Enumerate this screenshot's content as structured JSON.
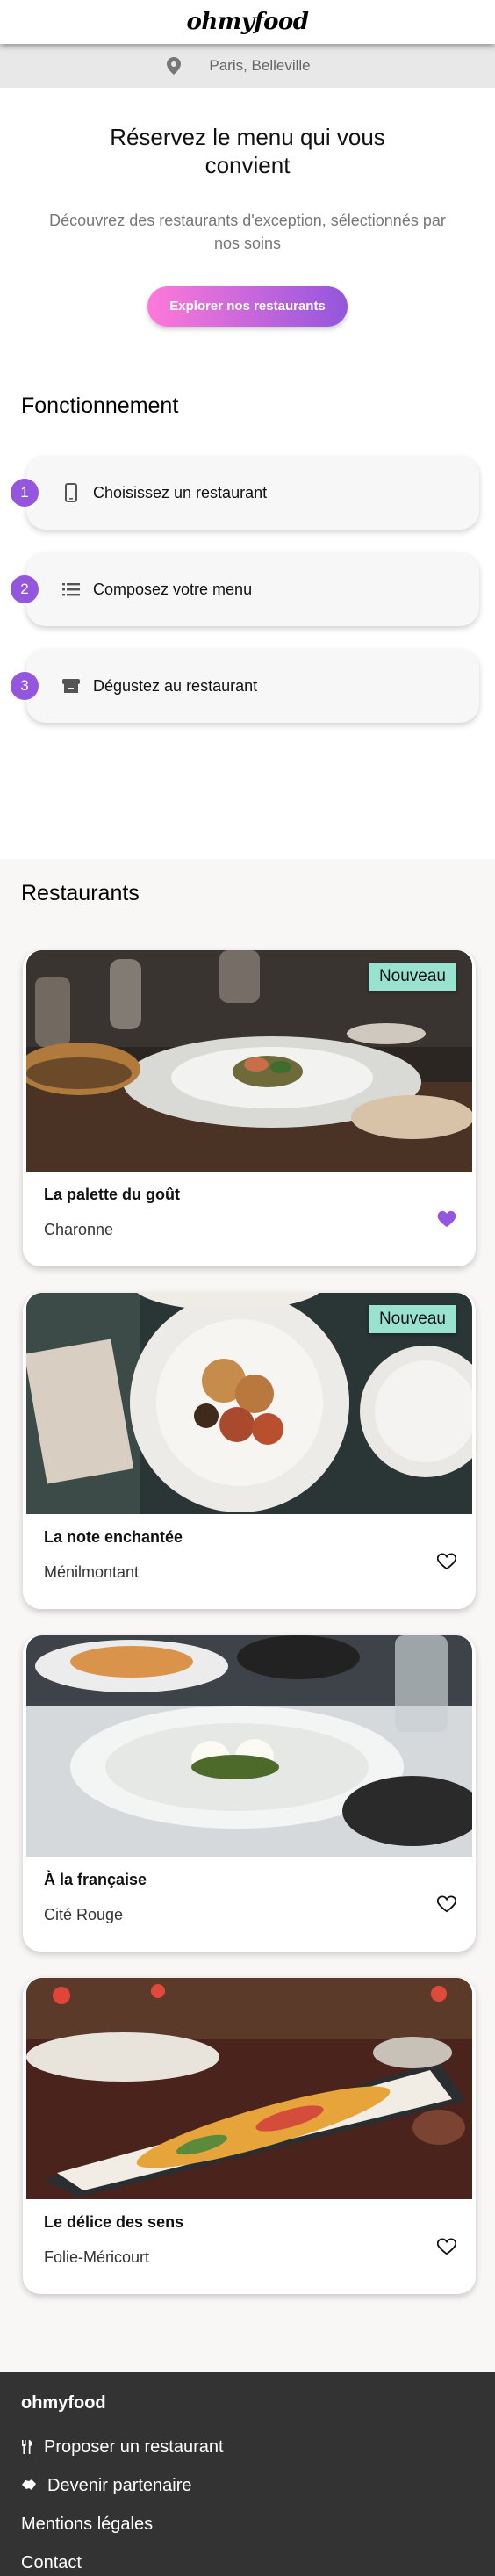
{
  "header": {
    "logo": "ohmyfood"
  },
  "location": {
    "text": "Paris, Belleville",
    "icon": "map-pin-icon"
  },
  "hero": {
    "title": "Réservez le menu qui vous convient",
    "subtitle": "Découvrez des restaurants d'exception, sélectionnés par nos soins",
    "cta_label": "Explorer nos restaurants"
  },
  "how": {
    "title": "Fonctionnement",
    "steps": [
      {
        "num": "1",
        "label": "Choisissez un restaurant",
        "icon": "phone-icon"
      },
      {
        "num": "2",
        "label": "Composez votre menu",
        "icon": "list-icon"
      },
      {
        "num": "3",
        "label": "Dégustez au restaurant",
        "icon": "store-icon"
      }
    ]
  },
  "restaurants": {
    "title": "Restaurants",
    "items": [
      {
        "name": "La palette du goût",
        "area": "Charonne",
        "badge": "Nouveau",
        "liked": true
      },
      {
        "name": "La note enchantée",
        "area": "Ménilmontant",
        "badge": "Nouveau",
        "liked": false
      },
      {
        "name": "À la française",
        "area": "Cité Rouge",
        "badge": "",
        "liked": false
      },
      {
        "name": "Le délice des sens",
        "area": "Folie-Méricourt",
        "badge": "",
        "liked": false
      }
    ]
  },
  "footer": {
    "logo": "ohmyfood",
    "links": [
      {
        "label": "Proposer un restaurant",
        "icon": "utensils-icon"
      },
      {
        "label": "Devenir partenaire",
        "icon": "handshake-icon"
      },
      {
        "label": "Mentions légales",
        "icon": ""
      },
      {
        "label": "Contact",
        "icon": ""
      }
    ]
  },
  "colors": {
    "accent": "#9356dc",
    "gradient_start": "#ff79da",
    "badge": "#99e2d0",
    "footer_bg": "#333333"
  }
}
